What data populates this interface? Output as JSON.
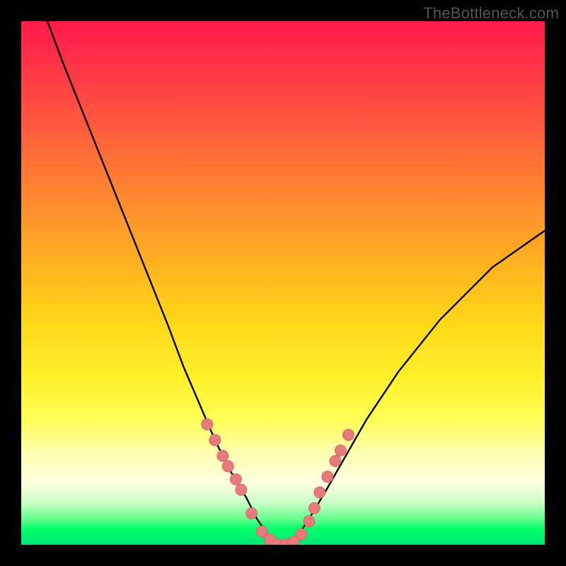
{
  "watermark": "TheBottleneck.com",
  "colors": {
    "curve": "#000000",
    "marker_fill": "#e77b7b",
    "marker_stroke": "#d86a6a",
    "gradient_top": "#ff1a4b",
    "gradient_bottom": "#00e676"
  },
  "chart_data": {
    "type": "line",
    "title": "",
    "xlabel": "",
    "ylabel": "",
    "xlim": [
      0,
      100
    ],
    "ylim": [
      0,
      100
    ],
    "grid": false,
    "legend": false,
    "series": [
      {
        "name": "bottleneck-curve",
        "x": [
          5,
          8,
          12,
          16,
          20,
          24,
          28,
          31,
          34,
          37,
          40,
          43,
          45,
          47,
          49,
          51,
          53,
          55,
          58,
          62,
          66,
          72,
          80,
          90,
          100
        ],
        "y": [
          100,
          92,
          82,
          72,
          62,
          52,
          42,
          34,
          27,
          20,
          14,
          9,
          5,
          2,
          0,
          0,
          2,
          5,
          10,
          17,
          24,
          33,
          43,
          53,
          60
        ]
      }
    ],
    "markers": {
      "name": "highlight-points",
      "x": [
        35.5,
        37,
        38.5,
        39.5,
        41,
        42,
        44,
        46,
        47.5,
        49,
        50.5,
        52,
        53.5,
        55,
        56,
        57,
        58.5,
        60,
        61,
        62.5
      ],
      "y": [
        23,
        20,
        17,
        15,
        12.5,
        10.5,
        6,
        2.5,
        1,
        0,
        0,
        0.5,
        2,
        4.5,
        7,
        10,
        13,
        16,
        18,
        21
      ]
    }
  }
}
